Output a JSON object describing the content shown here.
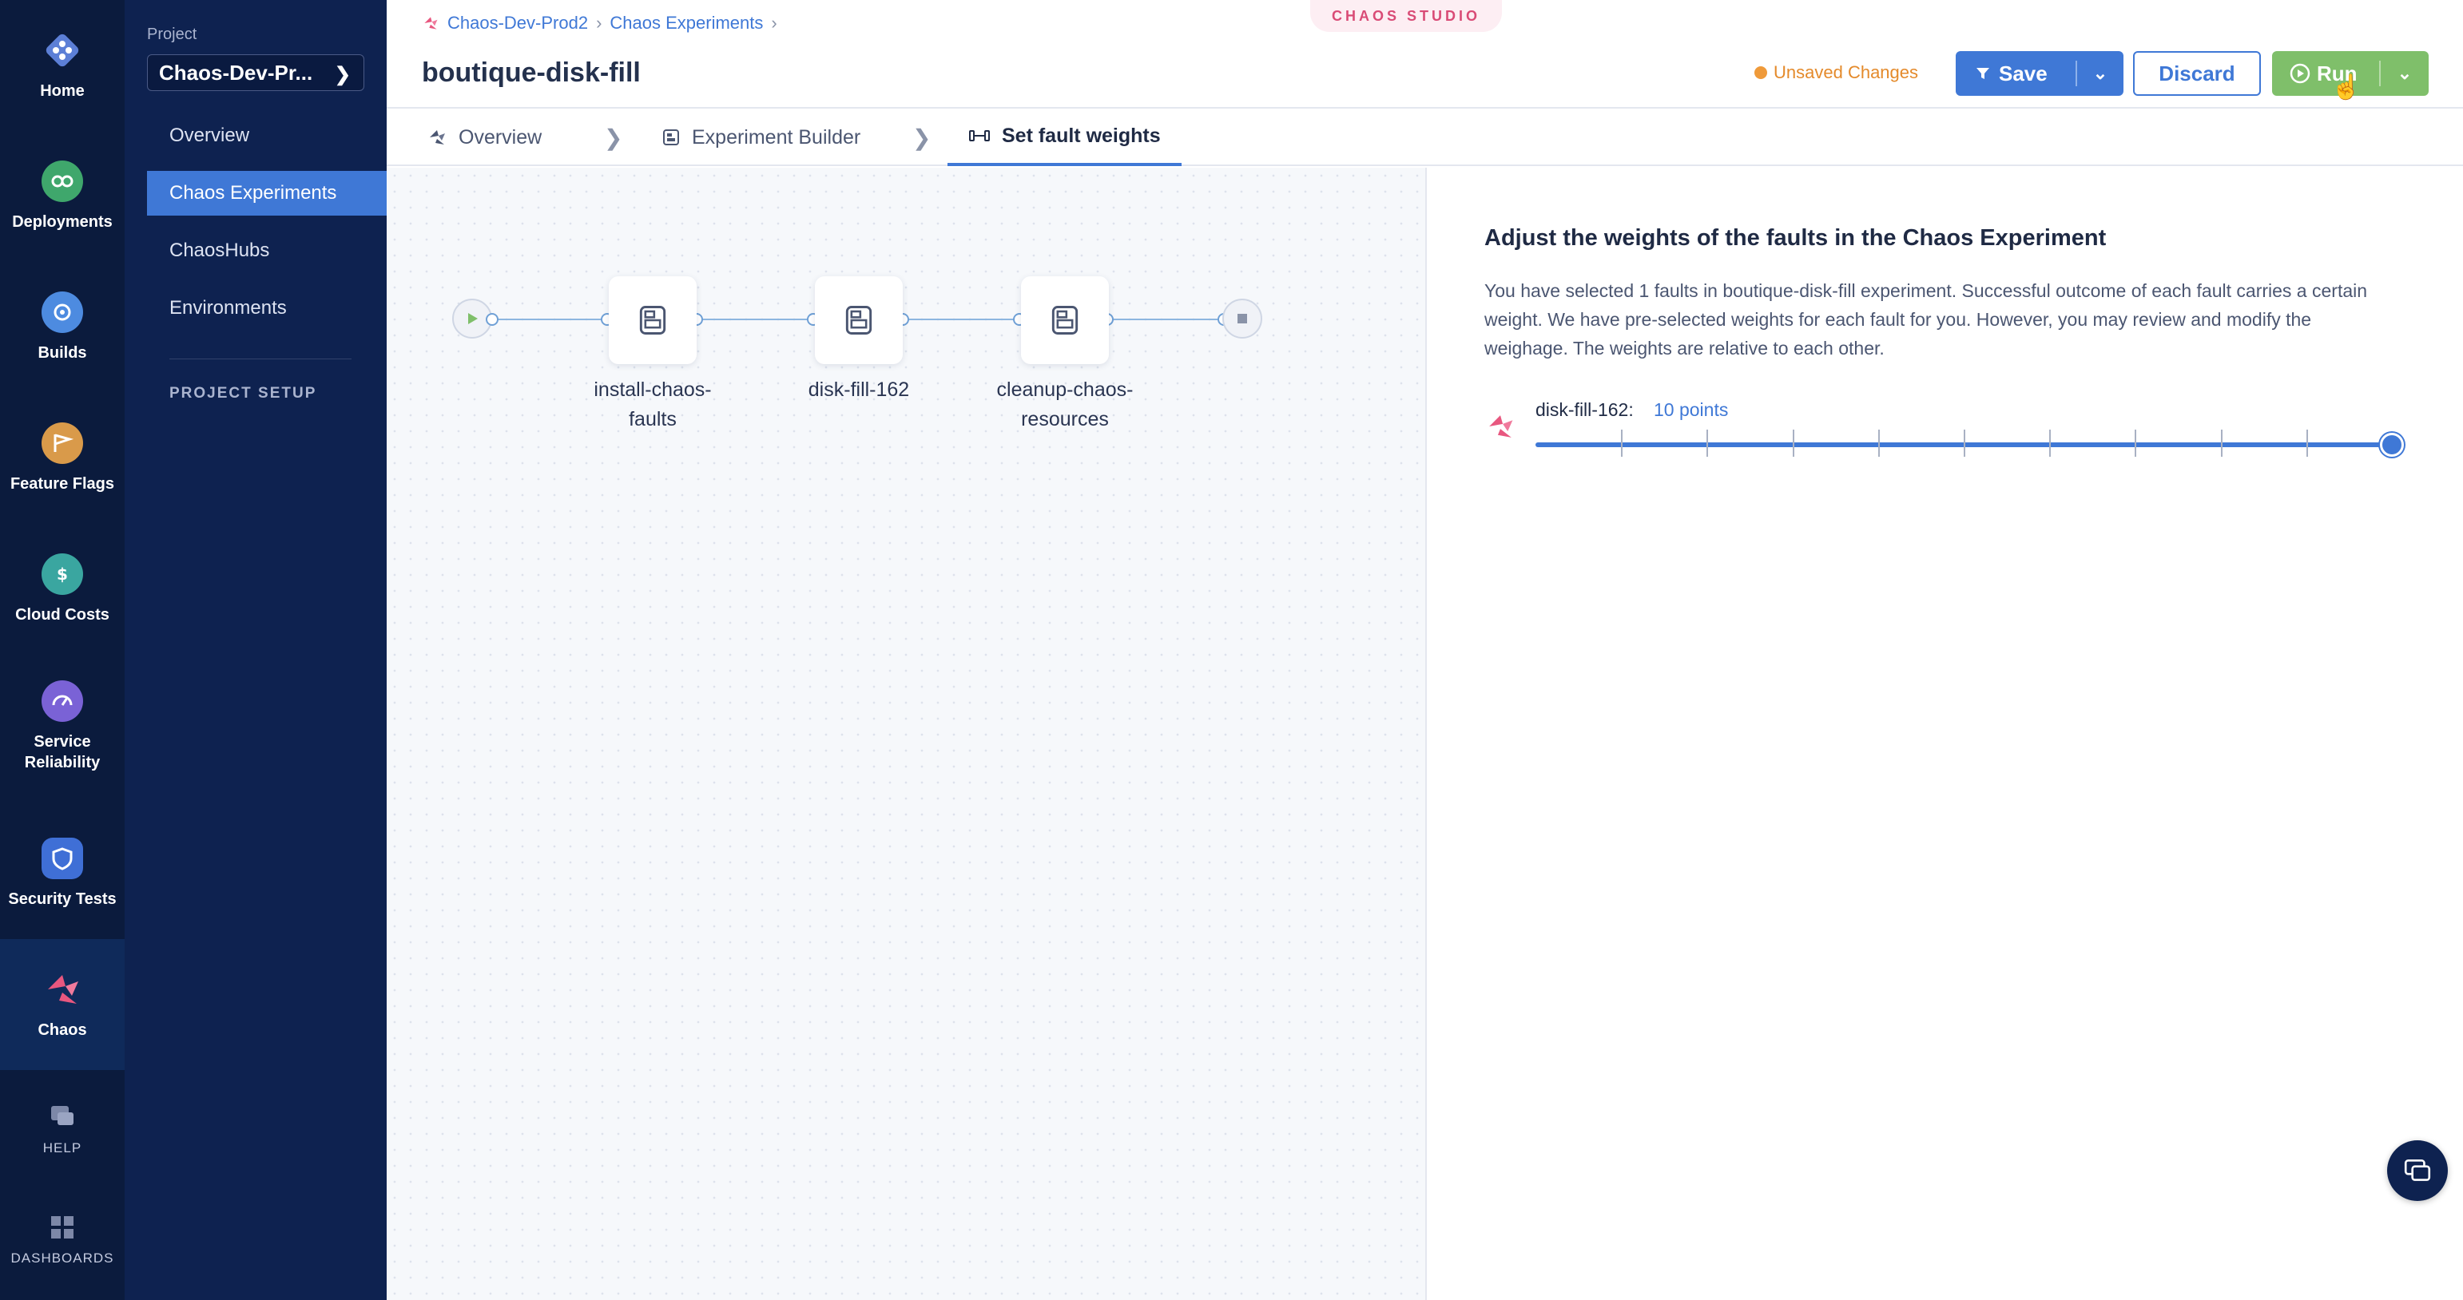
{
  "rail": {
    "items": [
      {
        "label": "Home",
        "icon": "home-icon"
      },
      {
        "label": "Deployments",
        "icon": "deployments-icon"
      },
      {
        "label": "Builds",
        "icon": "builds-icon"
      },
      {
        "label": "Feature Flags",
        "icon": "feature-flags-icon"
      },
      {
        "label": "Cloud Costs",
        "icon": "cloud-costs-icon"
      },
      {
        "label": "Service Reliability",
        "icon": "service-reliability-icon"
      },
      {
        "label": "Security Tests",
        "icon": "security-tests-icon"
      },
      {
        "label": "Chaos",
        "icon": "chaos-icon",
        "active": true
      }
    ],
    "help_label": "HELP",
    "dashboards_label": "DASHBOARDS"
  },
  "subnav": {
    "project_label": "Project",
    "project_value": "Chaos-Dev-Pr...",
    "items": [
      "Overview",
      "Chaos Experiments",
      "ChaosHubs",
      "Environments"
    ],
    "active_item": "Chaos Experiments",
    "project_setup": "PROJECT SETUP"
  },
  "header": {
    "breadcrumbs": [
      "Chaos-Dev-Prod2",
      "Chaos Experiments"
    ],
    "title": "boutique-disk-fill",
    "studio_tag": "CHAOS STUDIO",
    "unsaved": "Unsaved Changes",
    "save_label": "Save",
    "discard_label": "Discard",
    "run_label": "Run"
  },
  "tabs": [
    {
      "label": "Overview",
      "icon": "chaos-icon"
    },
    {
      "label": "Experiment Builder",
      "icon": "builder-icon"
    },
    {
      "label": "Set fault weights",
      "icon": "weights-icon",
      "active": true
    }
  ],
  "pipeline": {
    "nodes": [
      "install-chaos-faults",
      "disk-fill-162",
      "cleanup-chaos-resources"
    ],
    "node_label_lines": [
      [
        "install-chaos-",
        "faults"
      ],
      [
        "disk-fill-162"
      ],
      [
        "cleanup-chaos-",
        "resources"
      ]
    ]
  },
  "weights_panel": {
    "title": "Adjust the weights of the faults in the Chaos Experiment",
    "description": "You have selected 1 faults in boutique-disk-fill experiment. Successful outcome of each fault carries a certain weight. We have pre-selected weights for each fault for you. However, you may review and modify the weighage. The weights are relative to each other.",
    "faults": [
      {
        "name": "disk-fill-162:",
        "points": "10 points",
        "value": 10,
        "max": 10
      }
    ]
  },
  "colors": {
    "accent": "#3f78d6",
    "run_green": "#7fbf6a",
    "chaos_pink": "#d94b76",
    "unsaved_orange": "#e48a2b",
    "rail_bg": "#0b1b3d"
  }
}
